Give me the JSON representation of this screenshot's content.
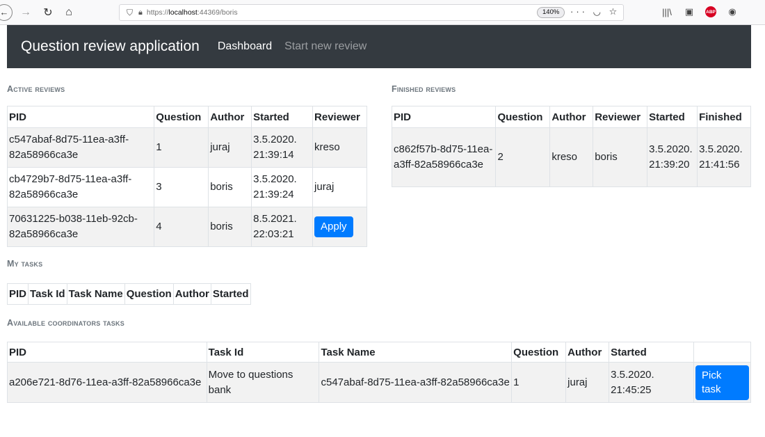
{
  "browser": {
    "back_icon": "←",
    "forward_icon": "→",
    "reload_icon": "↻",
    "home_icon": "⌂",
    "url_prefix": "https://",
    "url_host": "localhost",
    "url_rest": ":44369/boris",
    "zoom": "140%",
    "more_icon": "···",
    "pocket_icon": "◡",
    "bookmark_icon": "☆"
  },
  "app": {
    "brand": "Question review application",
    "nav": [
      "Dashboard",
      "Start new review"
    ]
  },
  "active_reviews": {
    "heading": "Active reviews",
    "columns": [
      "PID",
      "Question",
      "Author",
      "Started",
      "Reviewer"
    ],
    "rows": [
      {
        "pid": "c547abaf-8d75-11ea-a3ff-82a58966ca3e",
        "question": "1",
        "author": "juraj",
        "started": "3.5.2020. 21:39:14",
        "reviewer": "kreso"
      },
      {
        "pid": "cb4729b7-8d75-11ea-a3ff-82a58966ca3e",
        "question": "3",
        "author": "boris",
        "started": "3.5.2020. 21:39:24",
        "reviewer": "juraj"
      },
      {
        "pid": "70631225-b038-11eb-92cb-82a58966ca3e",
        "question": "4",
        "author": "boris",
        "started": "8.5.2021. 22:03:21",
        "action": "Apply"
      }
    ]
  },
  "finished_reviews": {
    "heading": "Finished reviews",
    "columns": [
      "PID",
      "Question",
      "Author",
      "Reviewer",
      "Started",
      "Finished"
    ],
    "rows": [
      {
        "pid": "c862f57b-8d75-11ea-a3ff-82a58966ca3e",
        "question": "2",
        "author": "kreso",
        "reviewer": "boris",
        "started": "3.5.2020. 21:39:20",
        "finished": "3.5.2020. 21:41:56"
      }
    ]
  },
  "my_tasks": {
    "heading": "My tasks",
    "columns": [
      "PID",
      "Task Id",
      "Task Name",
      "Question",
      "Author",
      "Started"
    ]
  },
  "coordinator_tasks": {
    "heading": "Available coordinators tasks",
    "columns": [
      "PID",
      "Task Id",
      "Task Name",
      "Question",
      "Author",
      "Started"
    ],
    "rows": [
      {
        "pid": "a206e721-8d76-11ea-a3ff-82a58966ca3e",
        "task_id": "Move to questions bank",
        "task_name": "c547abaf-8d75-11ea-a3ff-82a58966ca3e",
        "question": "1",
        "author": "juraj",
        "started": "3.5.2020. 21:45:25",
        "action": "Pick task"
      }
    ]
  }
}
